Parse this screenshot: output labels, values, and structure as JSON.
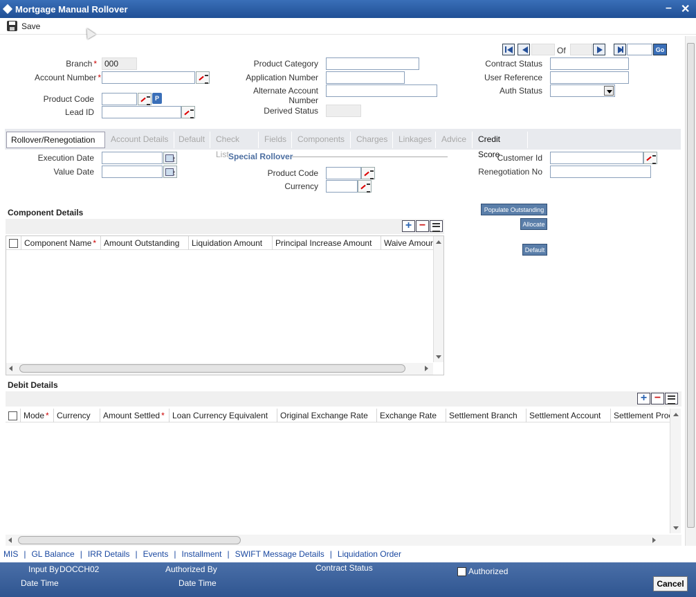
{
  "window": {
    "title": "Mortgage Manual Rollover"
  },
  "toolbar": {
    "save_label": "Save"
  },
  "header": {
    "branch_label": "Branch",
    "branch_value": "000",
    "account_number_label": "Account Number",
    "product_code_label": "Product Code",
    "product_code_button": "P",
    "lead_id_label": "Lead ID",
    "product_category_label": "Product Category",
    "application_number_label": "Application Number",
    "alternate_account_label_1": "Alternate Account",
    "alternate_account_label_2": "Number",
    "derived_status_label": "Derived Status",
    "of_label": "Of",
    "go_label": "Go",
    "contract_status_label": "Contract Status",
    "user_reference_label": "User Reference",
    "auth_status_label": "Auth Status"
  },
  "tabs": [
    {
      "label": "Rollover/Renegotiation"
    },
    {
      "label": "Account Details"
    },
    {
      "label": "Default"
    },
    {
      "label": "Check List"
    },
    {
      "label": "Fields"
    },
    {
      "label": "Components"
    },
    {
      "label": "Charges"
    },
    {
      "label": "Linkages"
    },
    {
      "label": "Advice"
    },
    {
      "label": "Credit Score"
    }
  ],
  "rollover": {
    "execution_date_label": "Execution Date",
    "value_date_label": "Value Date",
    "special_rollover_label": "Special Rollover",
    "product_code_label": "Product Code",
    "currency_label": "Currency",
    "customer_id_label": "Customer Id",
    "renegotiation_no_label": "Renegotiation No",
    "calendar_badge": "2"
  },
  "component_details": {
    "title": "Component Details",
    "populate_button": "Populate Outstanding",
    "allocate_button": "Allocate",
    "default_button": "Default",
    "columns": [
      "Component Name",
      "Amount Outstanding",
      "Liquidation Amount",
      "Principal Increase Amount",
      "Waive Amour"
    ],
    "rows": []
  },
  "debit_details": {
    "title": "Debit Details",
    "columns": [
      "Mode",
      "Currency",
      "Amount Settled",
      "Loan Currency Equivalent",
      "Original Exchange Rate",
      "Exchange Rate",
      "Settlement Branch",
      "Settlement Account",
      "Settlement Proc"
    ],
    "rows": []
  },
  "footer_links": [
    "MIS",
    "GL Balance",
    "IRR Details",
    "Events",
    "Installment",
    "SWIFT Message Details",
    "Liquidation Order"
  ],
  "footer": {
    "input_by_label": "Input By",
    "input_by_value": "DOCCH02",
    "date_time_label": "Date Time",
    "authorized_by_label": "Authorized By",
    "date_time_label_2": "Date Time",
    "contract_status_label": "Contract Status",
    "authorized_label": "Authorized",
    "cancel_label": "Cancel"
  }
}
